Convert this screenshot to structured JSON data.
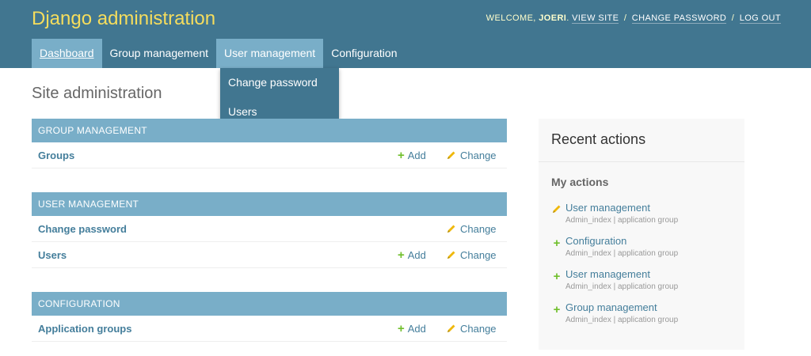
{
  "header": {
    "brand": "Django administration",
    "welcome": "Welcome,",
    "username": "Joeri",
    "view_site": "View site",
    "change_password": "Change password",
    "log_out": "Log out",
    "separator": "/"
  },
  "nav": {
    "items": [
      {
        "label": "Dashboard"
      },
      {
        "label": "Group management"
      },
      {
        "label": "User management"
      },
      {
        "label": "Configuration"
      }
    ],
    "dropdown": [
      {
        "label": "Change password"
      },
      {
        "label": "Users"
      }
    ]
  },
  "page_title": "Site administration",
  "modules": [
    {
      "caption": "Group management",
      "rows": [
        {
          "name": "Groups",
          "add": "Add",
          "change": "Change"
        }
      ]
    },
    {
      "caption": "User management",
      "rows": [
        {
          "name": "Change password",
          "change": "Change"
        },
        {
          "name": "Users",
          "add": "Add",
          "change": "Change"
        }
      ]
    },
    {
      "caption": "Configuration",
      "rows": [
        {
          "name": "Application groups",
          "add": "Add",
          "change": "Change"
        }
      ]
    }
  ],
  "recent": {
    "title": "Recent actions",
    "subtitle": "My actions",
    "actions": [
      {
        "icon": "pencil-icon",
        "label": "User management",
        "meta": "Admin_index | application group"
      },
      {
        "icon": "plus-icon",
        "label": "Configuration",
        "meta": "Admin_index | application group"
      },
      {
        "icon": "plus-icon",
        "label": "User management",
        "meta": "Admin_index | application group"
      },
      {
        "icon": "plus-icon",
        "label": "Group management",
        "meta": "Admin_index | application group"
      }
    ]
  },
  "colors": {
    "header_bg": "#417690",
    "brand": "#f5dd5d",
    "caption_bg": "#79aec8",
    "link": "#447e9b",
    "add_green": "#70bf2b",
    "change_yellow": "#efb80b"
  }
}
